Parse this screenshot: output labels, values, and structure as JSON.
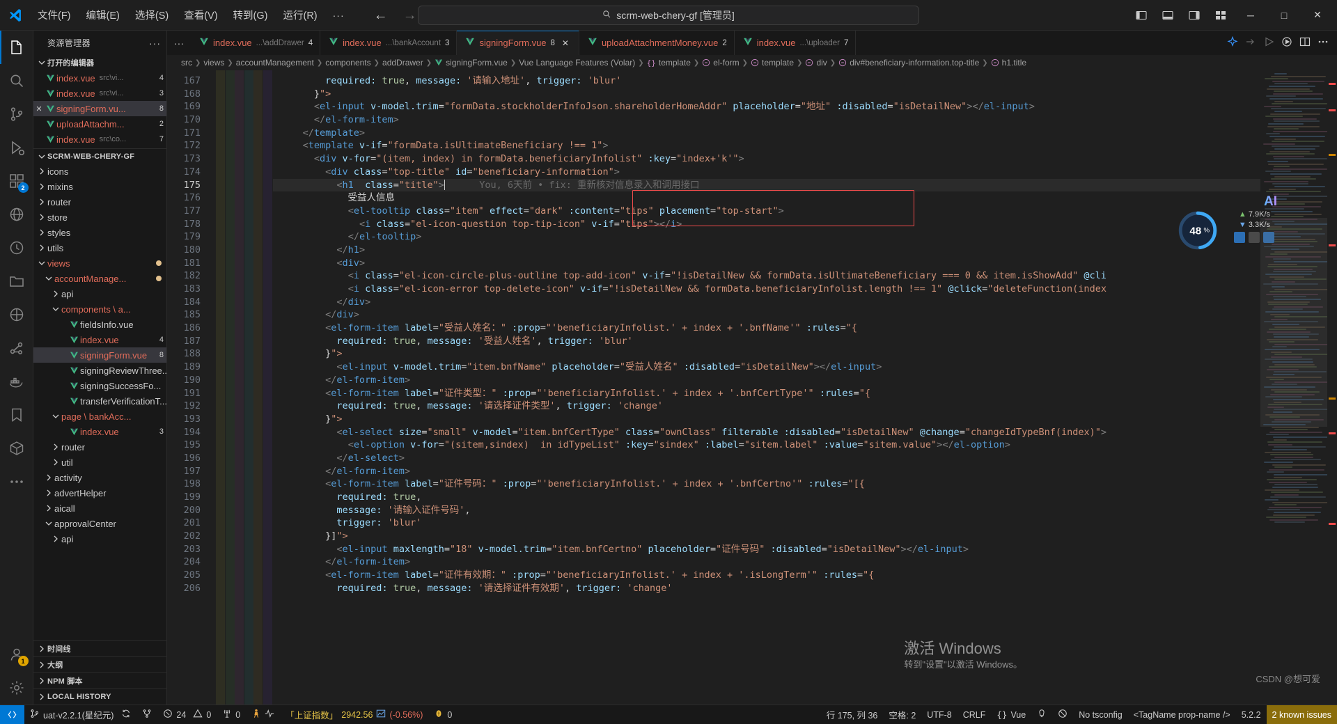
{
  "titlebar": {
    "menus": [
      "文件(F)",
      "编辑(E)",
      "选择(S)",
      "查看(V)",
      "转到(G)",
      "运行(R)"
    ],
    "more": "···",
    "back_icon": "arrow-left-icon",
    "forward_icon": "arrow-right-icon",
    "search_text": "scrm-web-chery-gf [管理员]",
    "search_icon": "search-icon",
    "layout_icons": [
      "toggle-primary-sidebar-icon",
      "toggle-panel-icon",
      "toggle-secondary-sidebar-icon",
      "customize-layout-icon"
    ],
    "window_minimize": "─",
    "window_maximize": "□",
    "window_close": "✕"
  },
  "activitybar": {
    "items": [
      {
        "name": "explorer",
        "icon": "files-icon",
        "badge": ""
      },
      {
        "name": "search",
        "icon": "search-icon",
        "badge": ""
      },
      {
        "name": "source-control",
        "icon": "source-control-icon",
        "badge": ""
      },
      {
        "name": "run-and-debug",
        "icon": "debug-icon",
        "badge": ""
      },
      {
        "name": "extensions",
        "icon": "extensions-icon",
        "badge": "2"
      },
      {
        "name": "remote-explorer",
        "icon": "remote-icon",
        "badge": ""
      },
      {
        "name": "todo-tree",
        "icon": "clock-icon",
        "badge": ""
      },
      {
        "name": "project-manager",
        "icon": "folder-library-icon",
        "badge": ""
      },
      {
        "name": "test-explorer",
        "icon": "beaker-icon",
        "badge": ""
      },
      {
        "name": "chart-view",
        "icon": "graph-icon",
        "badge": ""
      },
      {
        "name": "docker",
        "icon": "docker-icon",
        "badge": ""
      },
      {
        "name": "bookmarks",
        "icon": "bookmark-icon",
        "badge": ""
      },
      {
        "name": "package-view",
        "icon": "package-icon",
        "badge": ""
      },
      {
        "name": "more-views",
        "icon": "ellipsis-icon",
        "badge": ""
      }
    ],
    "bottom": [
      {
        "name": "accounts",
        "icon": "account-icon",
        "badge": "1"
      },
      {
        "name": "settings",
        "icon": "gear-icon",
        "badge": ""
      }
    ]
  },
  "sidebar": {
    "title": "资源管理器",
    "actions_icon": "ellipsis-icon",
    "open_editors": {
      "label": "打开的编辑器",
      "items": [
        {
          "name": "index.vue",
          "path": "src\\vi...",
          "count": "4",
          "selected": false,
          "dirty": false
        },
        {
          "name": "index.vue",
          "path": "src\\vi...",
          "count": "3",
          "selected": false,
          "dirty": false
        },
        {
          "name": "signingForm.vu...",
          "path": "",
          "count": "8",
          "selected": true,
          "dirty": false
        },
        {
          "name": "uploadAttachm...",
          "path": "",
          "count": "2",
          "selected": false,
          "dirty": false
        },
        {
          "name": "index.vue",
          "path": "src\\co...",
          "count": "7",
          "selected": false,
          "dirty": false
        }
      ]
    },
    "project": {
      "label": "SCRM-WEB-CHERY-GF",
      "nodes": [
        {
          "label": "icons",
          "type": "folder",
          "expanded": false,
          "depth": 1,
          "red": false,
          "count": ""
        },
        {
          "label": "mixins",
          "type": "folder",
          "expanded": false,
          "depth": 1,
          "red": false,
          "count": ""
        },
        {
          "label": "router",
          "type": "folder",
          "expanded": false,
          "depth": 1,
          "red": false,
          "count": ""
        },
        {
          "label": "store",
          "type": "folder",
          "expanded": false,
          "depth": 1,
          "red": false,
          "count": ""
        },
        {
          "label": "styles",
          "type": "folder",
          "expanded": false,
          "depth": 1,
          "red": false,
          "count": ""
        },
        {
          "label": "utils",
          "type": "folder",
          "expanded": false,
          "depth": 1,
          "red": false,
          "count": ""
        },
        {
          "label": "views",
          "type": "folder",
          "expanded": true,
          "depth": 1,
          "red": true,
          "count": "",
          "dot": true
        },
        {
          "label": "accountManage...",
          "type": "folder",
          "expanded": true,
          "depth": 2,
          "red": true,
          "count": "",
          "dot": true
        },
        {
          "label": "api",
          "type": "folder",
          "expanded": false,
          "depth": 3,
          "red": false,
          "count": ""
        },
        {
          "label": "components \\ a...",
          "type": "folder",
          "expanded": true,
          "depth": 3,
          "red": true,
          "count": ""
        },
        {
          "label": "fieldsInfo.vue",
          "type": "file",
          "depth": 4,
          "red": false,
          "count": ""
        },
        {
          "label": "index.vue",
          "type": "file",
          "depth": 4,
          "red": true,
          "count": "4"
        },
        {
          "label": "signingForm.vue",
          "type": "file",
          "depth": 4,
          "red": true,
          "count": "8",
          "selected": true
        },
        {
          "label": "signingReviewThree...",
          "type": "file",
          "depth": 4,
          "red": false,
          "count": ""
        },
        {
          "label": "signingSuccessFo...",
          "type": "file",
          "depth": 4,
          "red": false,
          "count": ""
        },
        {
          "label": "transferVerificationT...",
          "type": "file",
          "depth": 4,
          "red": false,
          "count": ""
        },
        {
          "label": "page \\ bankAcc...",
          "type": "folder",
          "expanded": true,
          "depth": 3,
          "red": true,
          "count": ""
        },
        {
          "label": "index.vue",
          "type": "file",
          "depth": 4,
          "red": true,
          "count": "3"
        },
        {
          "label": "router",
          "type": "folder",
          "expanded": false,
          "depth": 3,
          "red": false,
          "count": ""
        },
        {
          "label": "util",
          "type": "folder",
          "expanded": false,
          "depth": 3,
          "red": false,
          "count": ""
        },
        {
          "label": "activity",
          "type": "folder",
          "expanded": false,
          "depth": 2,
          "red": false,
          "count": ""
        },
        {
          "label": "advertHelper",
          "type": "folder",
          "expanded": false,
          "depth": 2,
          "red": false,
          "count": ""
        },
        {
          "label": "aicall",
          "type": "folder",
          "expanded": false,
          "depth": 2,
          "red": false,
          "count": ""
        },
        {
          "label": "approvalCenter",
          "type": "folder",
          "expanded": true,
          "depth": 2,
          "red": false,
          "count": ""
        },
        {
          "label": "api",
          "type": "folder",
          "expanded": false,
          "depth": 3,
          "red": false,
          "count": ""
        }
      ]
    },
    "bottom_sections": [
      "时间线",
      "大纲",
      "NPM 脚本",
      "LOCAL HISTORY"
    ]
  },
  "tabs": [
    {
      "name": "index.vue",
      "path": "...\\addDrawer",
      "count": "4",
      "active": false,
      "icon": "vue-icon"
    },
    {
      "name": "index.vue",
      "path": "...\\bankAccount",
      "count": "3",
      "active": false,
      "icon": "vue-icon"
    },
    {
      "name": "signingForm.vue",
      "path": "",
      "count": "8",
      "active": true,
      "icon": "vue-icon",
      "close": "✕"
    },
    {
      "name": "uploadAttachmentMoney.vue",
      "path": "",
      "count": "2",
      "active": false,
      "icon": "vue-icon"
    },
    {
      "name": "index.vue",
      "path": "...\\uploader",
      "count": "7",
      "active": false,
      "icon": "vue-icon"
    }
  ],
  "tabs_right_icons": [
    "sparkle-icon",
    "split-editor-right-icon",
    "run-icon",
    "debug-run-icon",
    "split-editor-icon",
    "more-actions-icon"
  ],
  "breadcrumb": [
    {
      "label": "src",
      "icon": ""
    },
    {
      "label": "views",
      "icon": ""
    },
    {
      "label": "accountManagement",
      "icon": ""
    },
    {
      "label": "components",
      "icon": ""
    },
    {
      "label": "addDrawer",
      "icon": ""
    },
    {
      "label": "signingForm.vue",
      "icon": "vue-icon"
    },
    {
      "label": "Vue Language Features (Volar)",
      "icon": ""
    },
    {
      "label": "template",
      "icon": "braces-icon"
    },
    {
      "label": "el-form",
      "icon": "symbol-icon"
    },
    {
      "label": "template",
      "icon": "symbol-icon"
    },
    {
      "label": "div",
      "icon": "symbol-icon"
    },
    {
      "label": "div#beneficiary-information.top-title",
      "icon": "symbol-icon"
    },
    {
      "label": "h1.title",
      "icon": "symbol-icon"
    }
  ],
  "code": {
    "first_line": 167,
    "current_line": 175,
    "blame": "You, 6天前 • fix: 重新核对信息录入和调用接口",
    "lines": [
      {
        "n": 167,
        "text": "        required: true, message: '请输入地址', trigger: 'blur'"
      },
      {
        "n": 168,
        "text": "      }\">"
      },
      {
        "n": 169,
        "text": "      <el-input v-model.trim=\"formData.stockholderInfoJson.shareholderHomeAddr\" placeholder=\"地址\" :disabled=\"isDetailNew\"></el-input>"
      },
      {
        "n": 170,
        "text": "      </el-form-item>"
      },
      {
        "n": 171,
        "text": "    </template>"
      },
      {
        "n": 172,
        "text": "    <template v-if=\"formData.isUltimateBeneficiary !== 1\">"
      },
      {
        "n": 173,
        "text": "      <div v-for=\"(item, index) in formData.beneficiaryInfolist\" :key=\"index+'k'\">"
      },
      {
        "n": 174,
        "text": "        <div class=\"top-title\" id=\"beneficiary-information\">"
      },
      {
        "n": 175,
        "text": "          <h1  class=\"title\">"
      },
      {
        "n": 176,
        "text": "            受益人信息"
      },
      {
        "n": 177,
        "text": "            <el-tooltip class=\"item\" effect=\"dark\" :content=\"tips\" placement=\"top-start\">"
      },
      {
        "n": 178,
        "text": "              <i class=\"el-icon-question top-tip-icon\" v-if=\"tips\"></i>"
      },
      {
        "n": 179,
        "text": "            </el-tooltip>"
      },
      {
        "n": 180,
        "text": "          </h1>"
      },
      {
        "n": 181,
        "text": "          <div>"
      },
      {
        "n": 182,
        "text": "            <i class=\"el-icon-circle-plus-outline top-add-icon\" v-if=\"!isDetailNew && formData.isUltimateBeneficiary === 0 && item.isShowAdd\" @cli"
      },
      {
        "n": 183,
        "text": "            <i class=\"el-icon-error top-delete-icon\" v-if=\"!isDetailNew && formData.beneficiaryInfolist.length !== 1\" @click=\"deleteFunction(index"
      },
      {
        "n": 184,
        "text": "          </div>"
      },
      {
        "n": 185,
        "text": "        </div>"
      },
      {
        "n": 186,
        "text": "        <el-form-item label=\"受益人姓名：\" :prop=\"'beneficiaryInfolist.' + index + '.bnfName'\" :rules=\"{"
      },
      {
        "n": 187,
        "text": "          required: true, message: '受益人姓名', trigger: 'blur'"
      },
      {
        "n": 188,
        "text": "        }\">"
      },
      {
        "n": 189,
        "text": "          <el-input v-model.trim=\"item.bnfName\" placeholder=\"受益人姓名\" :disabled=\"isDetailNew\"></el-input>"
      },
      {
        "n": 190,
        "text": "        </el-form-item>"
      },
      {
        "n": 191,
        "text": "        <el-form-item label=\"证件类型：\" :prop=\"'beneficiaryInfolist.' + index + '.bnfCertType'\" :rules=\"{"
      },
      {
        "n": 192,
        "text": "          required: true, message: '请选择证件类型', trigger: 'change'"
      },
      {
        "n": 193,
        "text": "        }\">"
      },
      {
        "n": 194,
        "text": "          <el-select size=\"small\" v-model=\"item.bnfCertType\" class=\"ownClass\" filterable :disabled=\"isDetailNew\" @change=\"changeIdTypeBnf(index)\">"
      },
      {
        "n": 195,
        "text": "            <el-option v-for=\"(sitem,sindex)  in idTypeList\" :key=\"sindex\" :label=\"sitem.label\" :value=\"sitem.value\"></el-option>"
      },
      {
        "n": 196,
        "text": "          </el-select>"
      },
      {
        "n": 197,
        "text": "        </el-form-item>"
      },
      {
        "n": 198,
        "text": "        <el-form-item label=\"证件号码：\" :prop=\"'beneficiaryInfolist.' + index + '.bnfCertno'\" :rules=\"[{"
      },
      {
        "n": 199,
        "text": "          required: true,"
      },
      {
        "n": 200,
        "text": "          message: '请输入证件号码',"
      },
      {
        "n": 201,
        "text": "          trigger: 'blur'"
      },
      {
        "n": 202,
        "text": "        }]\">"
      },
      {
        "n": 203,
        "text": "          <el-input maxlength=\"18\" v-model.trim=\"item.bnfCertno\" placeholder=\"证件号码\" :disabled=\"isDetailNew\"></el-input>"
      },
      {
        "n": 204,
        "text": "        </el-form-item>"
      },
      {
        "n": 205,
        "text": "        <el-form-item label=\"证件有效期：\" :prop=\"'beneficiaryInfolist.' + index + '.isLongTerm'\" :rules=\"{"
      },
      {
        "n": 206,
        "text": "          required: true, message: '请选择证件有效期', trigger: 'change'"
      }
    ]
  },
  "widgets": {
    "ai_label": "AI",
    "ring_percent": "48",
    "ring_suffix": "%",
    "net_up": "7.9K/s",
    "net_down": "3.3K/s"
  },
  "watermark": {
    "line1": "激活 Windows",
    "line2": "转到\"设置\"以激活 Windows。",
    "csdn": "CSDN @想可爱"
  },
  "statusbar": {
    "remote_icon": "remote-indicator-icon",
    "branch": "uat-v2.2.1(星纪元)",
    "branch_icon": "source-control-icon",
    "sync_icon": "sync-icon",
    "branch2_icon": "git-branch-icon",
    "errors_icon": "error-icon",
    "errors": "24",
    "warnings_icon": "warning-icon",
    "warnings": "0",
    "ports_icon": "radio-tower-icon",
    "ports": "0",
    "walkman_icon": "person-icon",
    "pulse_icon": "pulse-icon",
    "stock_label": "「上证指数」",
    "stock_value": "2942.56",
    "stock_chart_icon": "trend-chart-icon",
    "stock_change": "(-0.56%)",
    "coin_icon": "coin-icon",
    "coin_value": "0",
    "cursor": "行 175, 列 36",
    "indent": "空格: 2",
    "encoding": "UTF-8",
    "eol": "CRLF",
    "lang_icon": "braces-icon",
    "language": "Vue",
    "bell_icon": "gitlens-icon",
    "prettier_icon": "prettier-icon",
    "tsconfig": "No tsconfig",
    "tagname": "<TagName prop-name />",
    "version": "5.2.2",
    "issues": "2 known issues",
    "issues_bg": "#8a6d0b"
  }
}
